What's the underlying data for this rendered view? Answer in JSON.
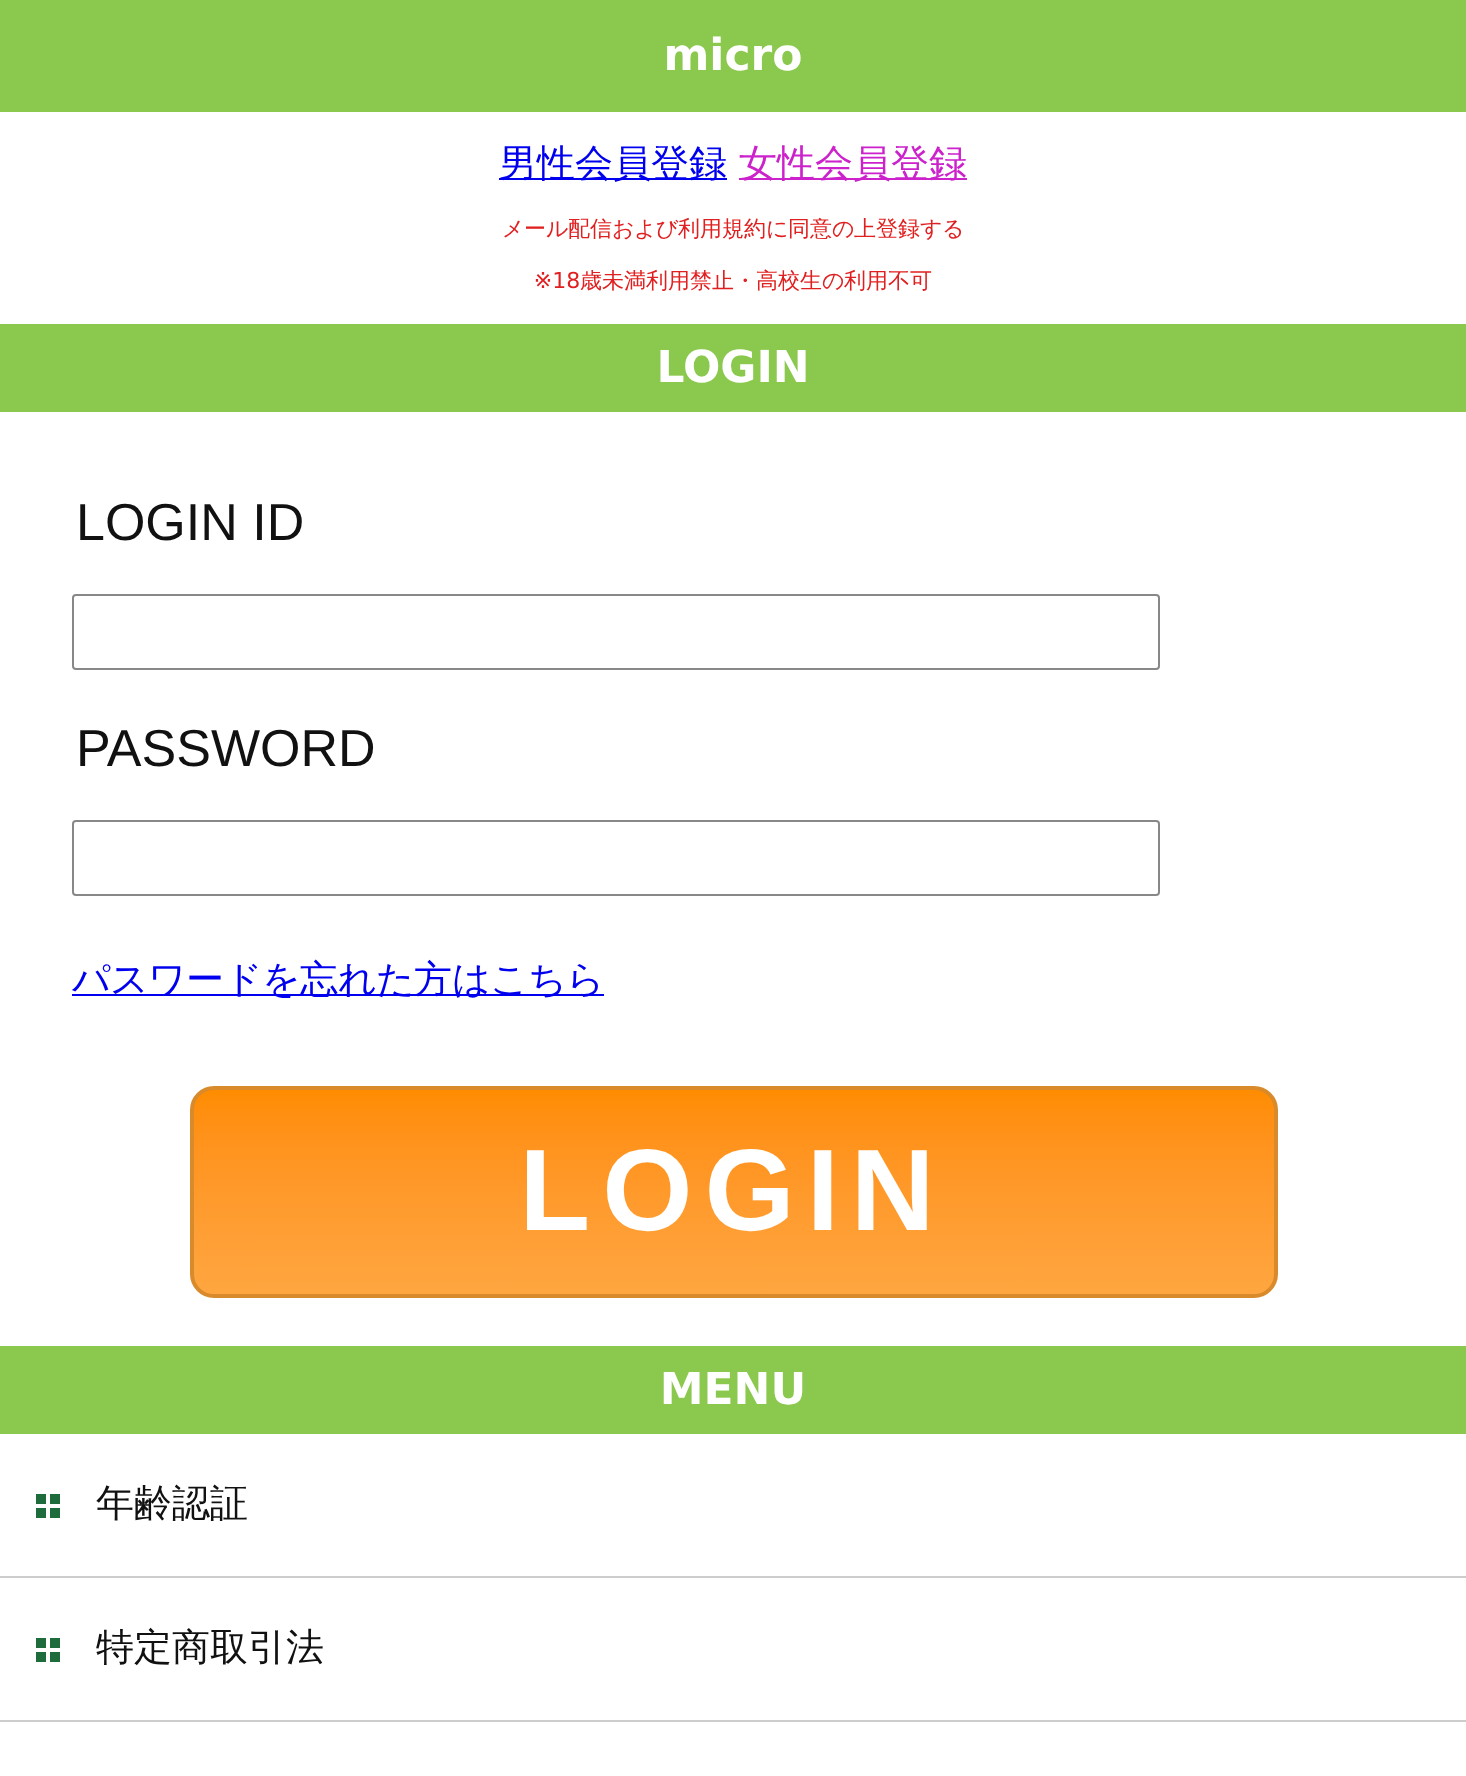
{
  "header": {
    "title": "micro"
  },
  "register_links": [
    {
      "label": "男性会員登録",
      "visited": false
    },
    {
      "label": "女性会員登録",
      "visited": true
    }
  ],
  "notices": [
    "メール配信および利用規約に同意の上登録する",
    "※18歳未満利用禁止・高校生の利用不可"
  ],
  "login": {
    "heading": "LOGIN",
    "id_label": "LOGIN ID",
    "password_label": "PASSWORD",
    "forgot_link": "パスワードを忘れた方はこちら",
    "button": "LOGIN"
  },
  "menu": {
    "heading": "MENU",
    "items": [
      "年齢認証",
      "特定商取引法"
    ]
  }
}
